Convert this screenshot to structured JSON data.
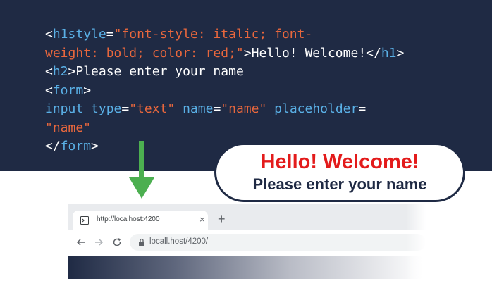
{
  "code": {
    "lines": [
      [
        {
          "t": "<",
          "k": "text"
        },
        {
          "t": "h1",
          "k": "tag"
        },
        {
          "t": "style",
          "k": "attr"
        },
        {
          "t": "=",
          "k": "text"
        },
        {
          "t": "\"font-style: italic; font-",
          "k": "str"
        }
      ],
      [
        {
          "t": "weight: bold; color: red;\"",
          "k": "str"
        },
        {
          "t": ">Hello! Welcome!</",
          "k": "text"
        },
        {
          "t": "h1",
          "k": "tag"
        },
        {
          "t": ">",
          "k": "text"
        }
      ],
      [
        {
          "t": "<",
          "k": "text"
        },
        {
          "t": "h2",
          "k": "tag"
        },
        {
          "t": ">Please enter your name",
          "k": "text"
        }
      ],
      [
        {
          "t": "<",
          "k": "text"
        },
        {
          "t": "form",
          "k": "tag"
        },
        {
          "t": ">",
          "k": "text"
        }
      ],
      [
        {
          "t": "input",
          "k": "tag"
        },
        {
          "t": " type",
          "k": "attr"
        },
        {
          "t": "=",
          "k": "text"
        },
        {
          "t": "\"text\"",
          "k": "str"
        },
        {
          "t": " name",
          "k": "attr"
        },
        {
          "t": "=",
          "k": "text"
        },
        {
          "t": "\"name\"",
          "k": "str"
        },
        {
          "t": " placeholder",
          "k": "attr"
        },
        {
          "t": "=",
          "k": "text"
        }
      ],
      [
        {
          "t": "\"name\"",
          "k": "str"
        }
      ],
      [
        {
          "t": "</",
          "k": "text"
        },
        {
          "t": "form",
          "k": "tag"
        },
        {
          "t": ">",
          "k": "text"
        }
      ]
    ]
  },
  "preview": {
    "h1": "Hello! Welcome!",
    "h2": "Please enter your name"
  },
  "browser": {
    "tab_title": "http://localhost:4200",
    "tab_close": "×",
    "new_tab": "+",
    "url": "locall.host/4200/"
  },
  "colors": {
    "panel_bg": "#1f2a44",
    "tag": "#5ab0e6",
    "string": "#e8673d",
    "heading_red": "#e31b1b",
    "arrow_green": "#4caf50"
  },
  "icons": {
    "arrow": "down-arrow-icon",
    "tab": "terminal-icon",
    "back": "back-arrow-icon",
    "forward": "forward-arrow-icon",
    "reload": "reload-icon",
    "lock": "lock-icon"
  }
}
